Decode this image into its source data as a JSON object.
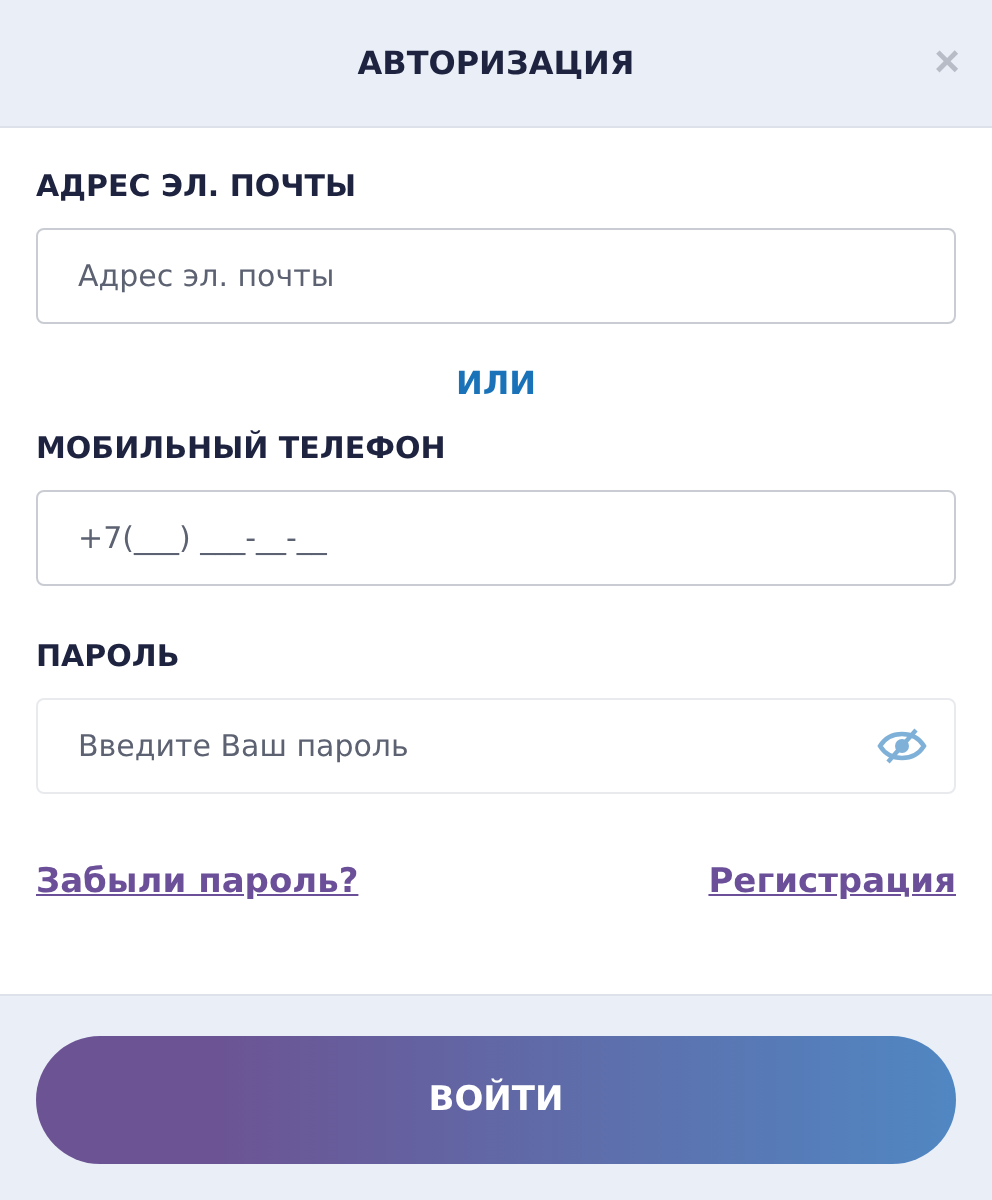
{
  "dialog": {
    "title": "АВТОРИЗАЦИЯ",
    "close": "×"
  },
  "fields": [
    {
      "kind": "email",
      "label": "АДРЕС ЭЛ. ПОЧТЫ",
      "placeholder": "Адрес эл. почты"
    },
    {
      "kind": "separator",
      "text": "ИЛИ"
    },
    {
      "kind": "phone",
      "label": "МОБИЛЬНЫЙ ТЕЛЕФОН",
      "placeholder": "+7(___) ___-__-__"
    },
    {
      "kind": "password",
      "label": "ПАРОЛЬ",
      "placeholder": "Введите Ваш пароль",
      "visible": false
    }
  ],
  "links": [
    "Забыли пароль?",
    "Регистрация"
  ],
  "submit": "ВОЙТИ"
}
